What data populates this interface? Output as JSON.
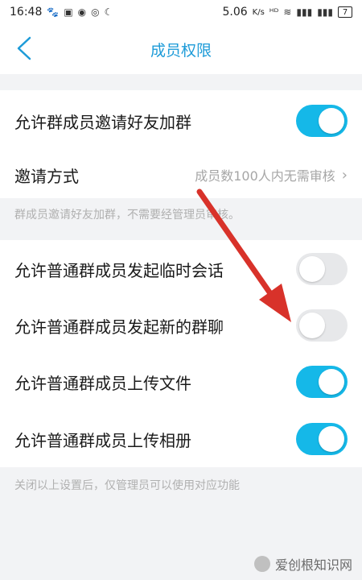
{
  "status_bar": {
    "time": "16:48",
    "network_speed": "5.06",
    "network_unit": "K/s",
    "battery": "7"
  },
  "header": {
    "title": "成员权限"
  },
  "settings": {
    "invite_toggle_label": "允许群成员邀请好友加群",
    "invite_toggle_on": true,
    "invite_method_label": "邀请方式",
    "invite_method_value": "成员数100人内无需审核",
    "invite_note": "群成员邀请好友加群，不需要经管理员审核。",
    "items": [
      {
        "label": "允许普通群成员发起临时会话",
        "on": false
      },
      {
        "label": "允许普通群成员发起新的群聊",
        "on": false
      },
      {
        "label": "允许普通群成员上传文件",
        "on": true
      },
      {
        "label": "允许普通群成员上传相册",
        "on": true
      }
    ],
    "bottom_note": "关闭以上设置后，仅管理员可以使用对应功能"
  },
  "colors": {
    "accent": "#15b8e8",
    "title": "#1d9bd8",
    "arrow": "#d8322a"
  },
  "watermark": {
    "text": "爱创根知识网"
  }
}
